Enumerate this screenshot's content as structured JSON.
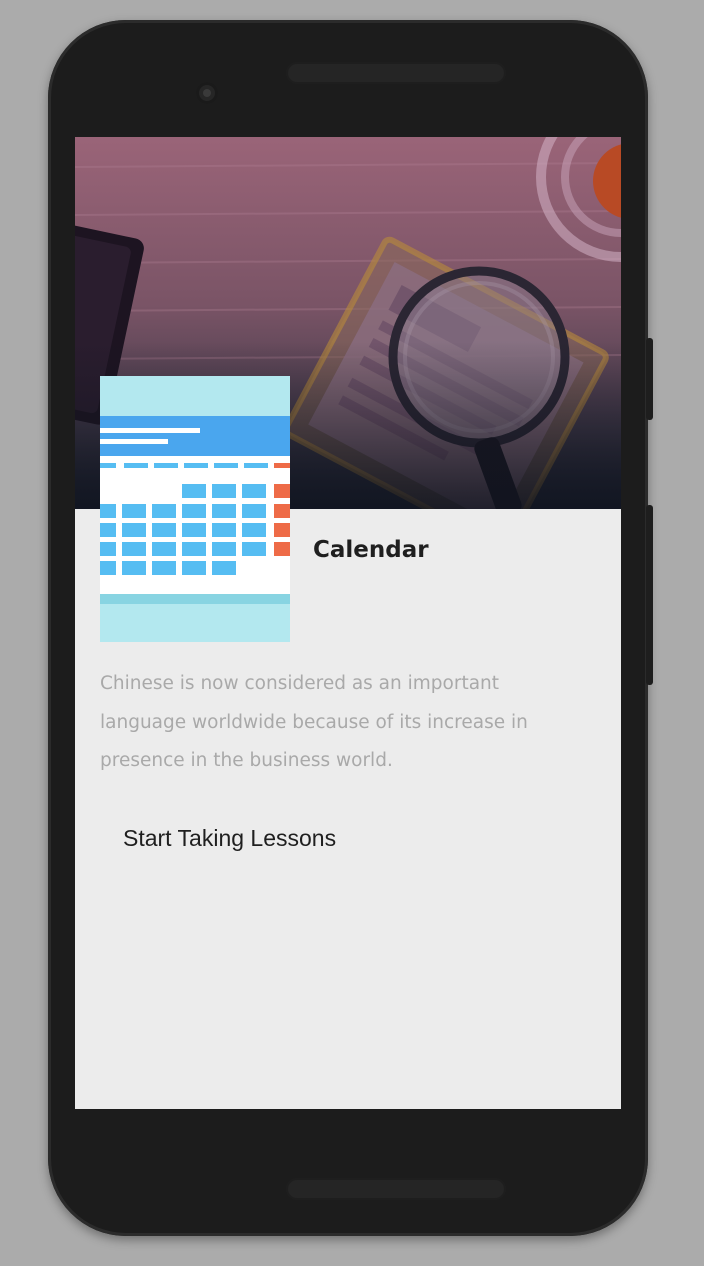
{
  "screen": {
    "title": "Calendar",
    "description": "Chinese is now considered as an important language worldwide because of its increase in presence in the business world.",
    "cta_label": "Start Taking Lessons",
    "hero_image": "desk-with-magnifying-glass-illustration",
    "thumbnail": "calendar-illustration"
  },
  "colors": {
    "background": "#ababab",
    "device": "#1c1c1c",
    "screen_background": "#ececec",
    "title_text": "#1f1f1f",
    "description_text": "#a9a9a9",
    "calendar_header": "#4aa6ee",
    "calendar_cell": "#56bdf2",
    "calendar_accent": "#ee6b47",
    "calendar_frame": "#b3e8ef"
  }
}
